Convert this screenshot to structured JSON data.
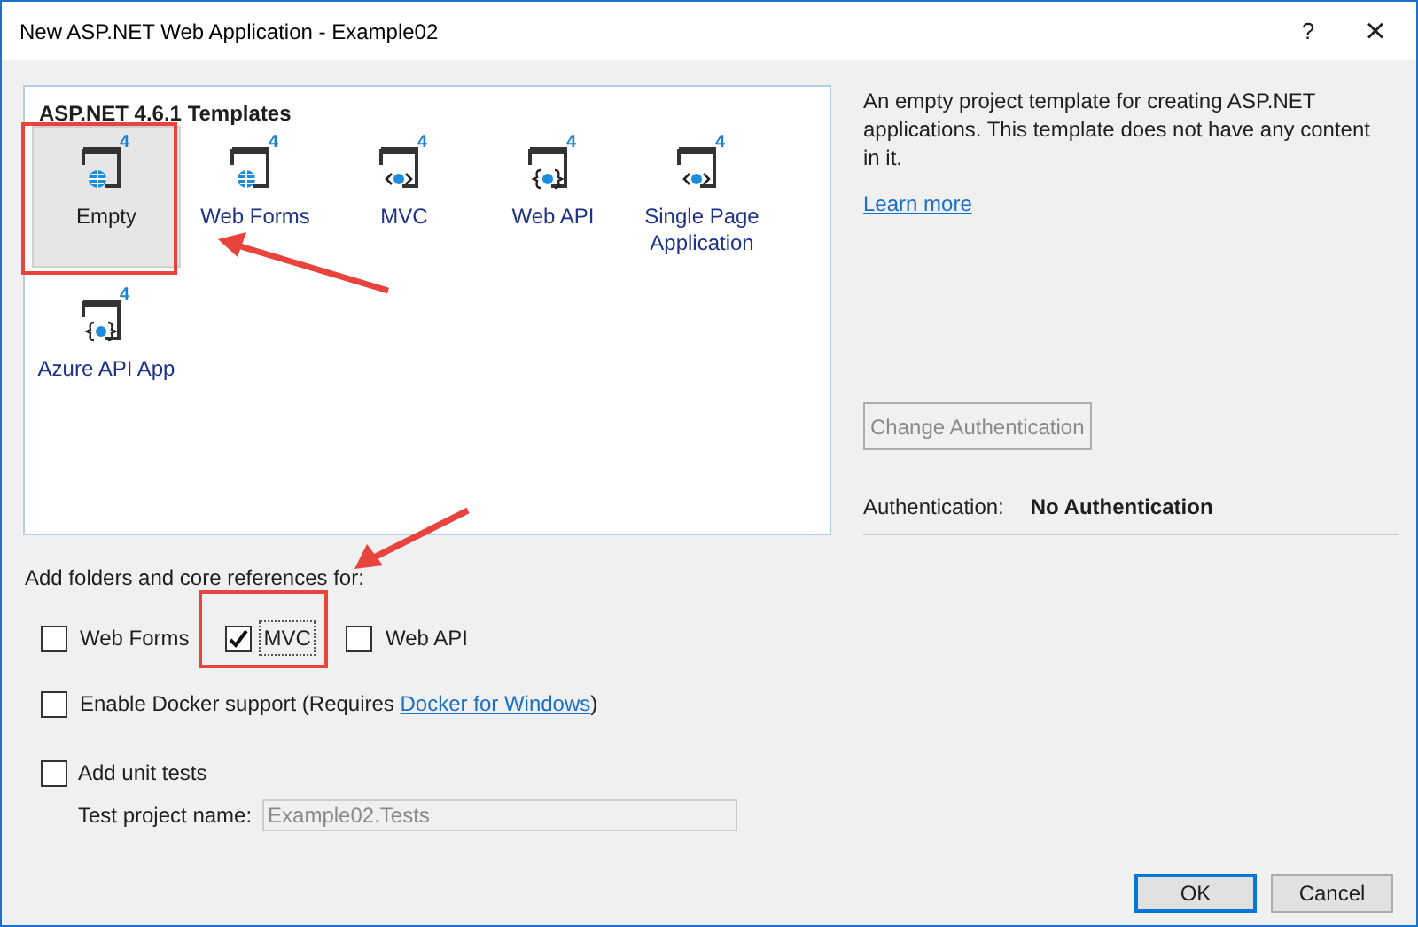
{
  "window": {
    "title": "New ASP.NET Web Application - Example02",
    "help": "?",
    "close": "×"
  },
  "templates": {
    "heading": "ASP.NET 4.6.1 Templates",
    "items": [
      {
        "label": "Empty",
        "kind": "globe",
        "badge": "4",
        "selected": true
      },
      {
        "label": "Web Forms",
        "kind": "globe",
        "badge": "4",
        "selected": false
      },
      {
        "label": "MVC",
        "kind": "tags",
        "badge": "4",
        "selected": false
      },
      {
        "label": "Web API",
        "kind": "braces",
        "badge": "4",
        "selected": false
      },
      {
        "label": "Single Page Application",
        "kind": "tags",
        "badge": "4",
        "selected": false
      },
      {
        "label": "Azure API App",
        "kind": "braces",
        "badge": "4",
        "selected": false
      }
    ]
  },
  "description": {
    "text": "An empty project template for creating ASP.NET applications. This template does not have any content in it.",
    "link": "Learn more"
  },
  "change_authentication": {
    "label": "Change Authentication",
    "disabled": true
  },
  "authentication": {
    "label": "Authentication:",
    "value": "No Authentication"
  },
  "references": {
    "heading": "Add folders and core references for:",
    "options": [
      {
        "label": "Web Forms",
        "checked": false
      },
      {
        "label": "MVC",
        "checked": true
      },
      {
        "label": "Web API",
        "checked": false
      }
    ]
  },
  "docker": {
    "label": "Enable Docker support (Requires ",
    "link": "Docker for Windows",
    "suffix": ")",
    "checked": false
  },
  "unit_tests": {
    "label": "Add unit tests",
    "checked": false,
    "name_label": "Test project name:",
    "name_value": "Example02.Tests",
    "disabled": true
  },
  "buttons": [
    {
      "label": "OK",
      "default": true
    },
    {
      "label": "Cancel",
      "default": false
    }
  ]
}
